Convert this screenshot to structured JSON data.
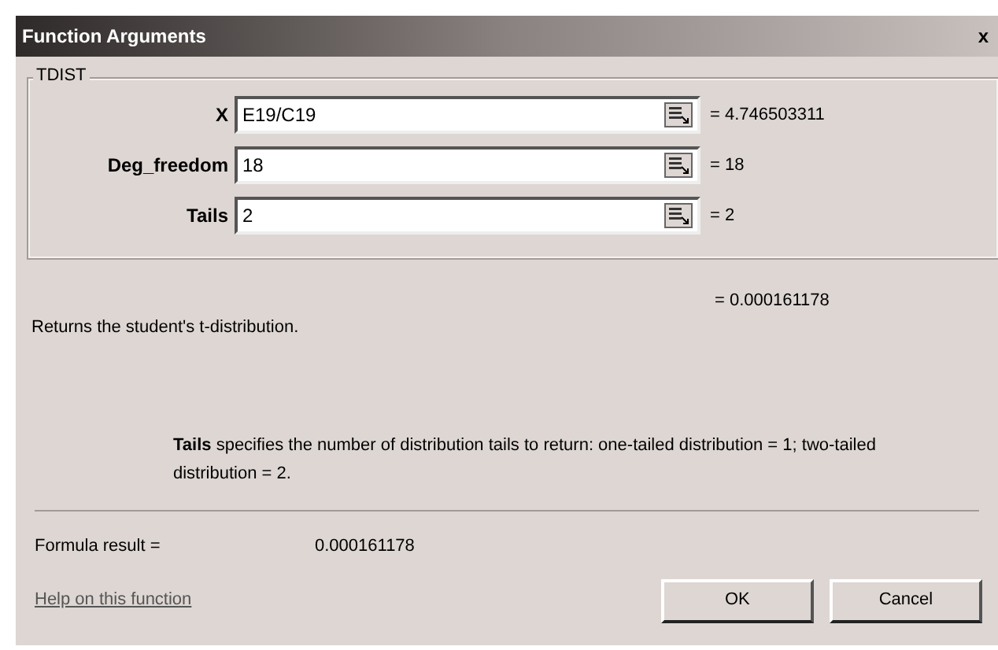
{
  "window": {
    "title": "Function Arguments",
    "close": "x"
  },
  "group": {
    "title": "TDIST",
    "args": [
      {
        "label": "X",
        "value": "E19/C19",
        "result": "= 4.746503311"
      },
      {
        "label": "Deg_freedom",
        "value": "18",
        "result": "= 18"
      },
      {
        "label": "Tails",
        "value": "2",
        "result": "= 2"
      }
    ],
    "result": "= 0.000161178"
  },
  "description": "Returns the student's t-distribution.",
  "arg_help": "**Tails** specifies the number of distribution tails to return: one-tailed distribution = 1; two-tailed distribution = 2.",
  "formula_result": {
    "label": "Formula result =",
    "value": "0.000161178"
  },
  "help_link": "Help on this function",
  "buttons": [
    "OK",
    "Cancel"
  ]
}
